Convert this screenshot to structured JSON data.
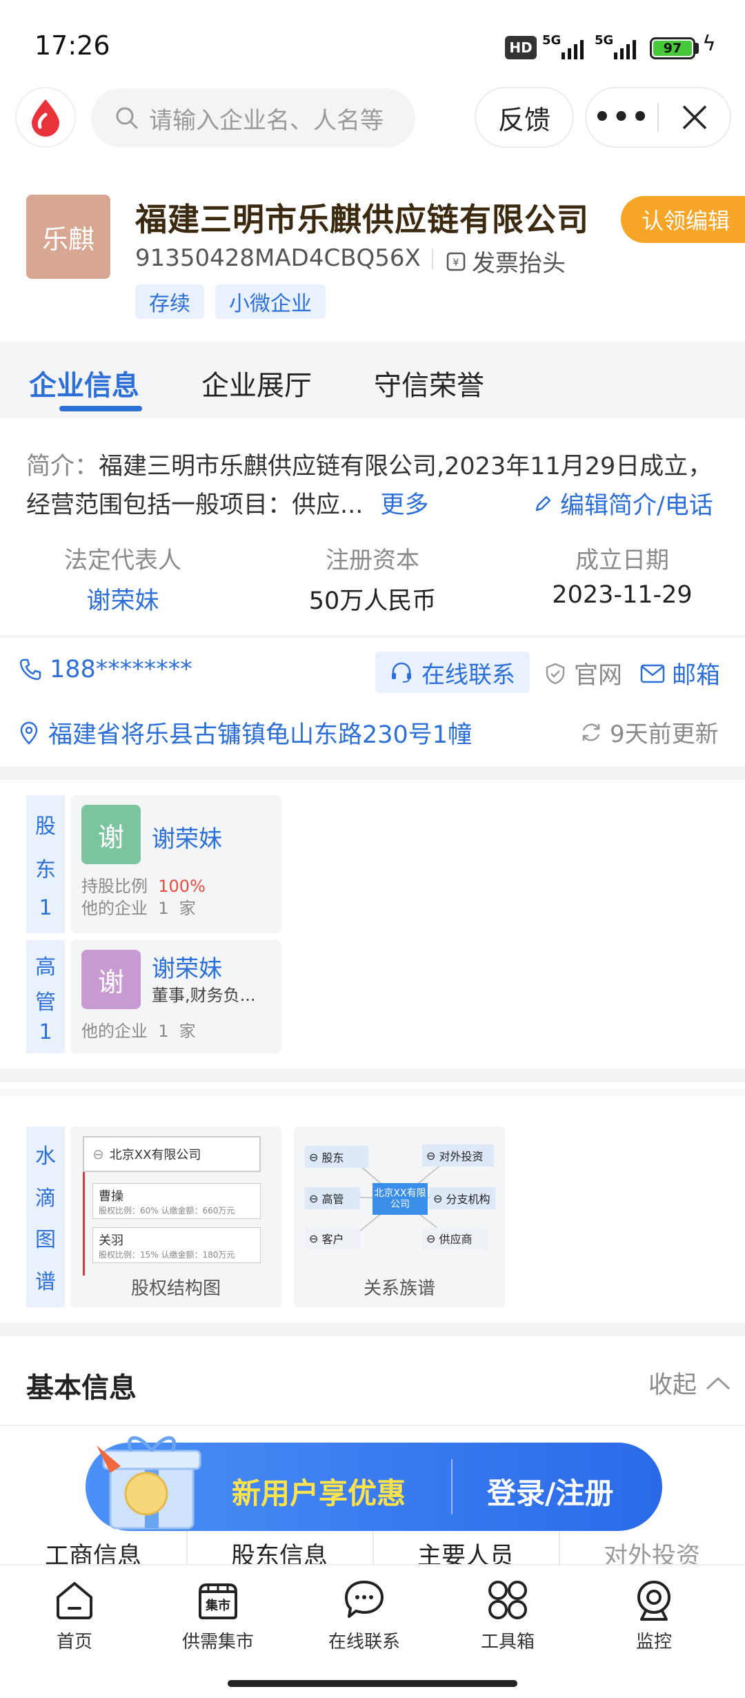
{
  "status_bar": {
    "time": "17:26",
    "hd": "HD",
    "net1": "5G",
    "net2": "5G",
    "battery": "97"
  },
  "top_bar": {
    "search_placeholder": "请输入企业名、人名等",
    "feedback": "反馈"
  },
  "company": {
    "logo_text": "乐麒",
    "name": "福建三明市乐麒供应链有限公司",
    "credit_code": "91350428MAD4CBQ56X",
    "invoice": "发票抬头",
    "claim": "认领编辑",
    "tags": [
      "存续",
      "小微企业"
    ]
  },
  "tabs": [
    "企业信息",
    "企业展厅",
    "守信荣誉"
  ],
  "intro": {
    "label": "简介：",
    "text": "福建三明市乐麒供应链有限公司,2023年11月29日成立，经营范围包括一般项目：供应...",
    "more": "更多",
    "edit": "编辑简介/电话"
  },
  "key_info": [
    {
      "label": "法定代表人",
      "value": "谢荣妹"
    },
    {
      "label": "注册资本",
      "value": "50万人民币"
    },
    {
      "label": "成立日期",
      "value": "2023-11-29"
    }
  ],
  "contact": {
    "phone": "188********",
    "online": "在线联系",
    "website": "官网",
    "email": "邮箱",
    "address": "福建省将乐县古镛镇龟山东路230号1幢",
    "updated": "9天前更新"
  },
  "shareholders": {
    "side": [
      "股",
      "东",
      "1"
    ],
    "avatar": "谢",
    "name": "谢荣妹",
    "ratio_label": "持股比例",
    "ratio": "100%",
    "other": "他的企业  1  家"
  },
  "executives": {
    "side": [
      "高",
      "管",
      "1"
    ],
    "avatar": "谢",
    "name": "谢荣妹",
    "role": "董事,财务负...",
    "other": "他的企业  1  家"
  },
  "graphs": {
    "side": [
      "水",
      "滴",
      "图",
      "谱"
    ],
    "equity": {
      "caption": "股权结构图",
      "company": "北京XX有限公司",
      "p1": "曹操",
      "p1_detail": "股权比例：60%   认缴金额：660万元",
      "p2": "关羽",
      "p2_detail": "股权比例：15%   认缴金额：180万元"
    },
    "relation": {
      "caption": "关系族谱",
      "center": "北京XX有限公司",
      "nodes": [
        "股东",
        "对外投资",
        "高管",
        "分支机构",
        "客户",
        "供应商"
      ]
    }
  },
  "basic": {
    "title": "基本信息",
    "collapse": "收起",
    "grid": [
      "工商信息",
      "股东信息",
      "主要人员",
      "对外投资"
    ]
  },
  "promo": {
    "left": "新用户享优惠",
    "right": "登录/注册"
  },
  "bottom_nav": [
    {
      "label": "首页",
      "icon": "home-icon"
    },
    {
      "label": "供需集市",
      "icon": "market-icon",
      "badge": "集市"
    },
    {
      "label": "在线联系",
      "icon": "chat-icon"
    },
    {
      "label": "工具箱",
      "icon": "toolbox-icon"
    },
    {
      "label": "监控",
      "icon": "monitor-icon"
    }
  ],
  "colors": {
    "accent": "#2c6fd6",
    "claim": "#f7a526",
    "logo": "#d8a792"
  }
}
